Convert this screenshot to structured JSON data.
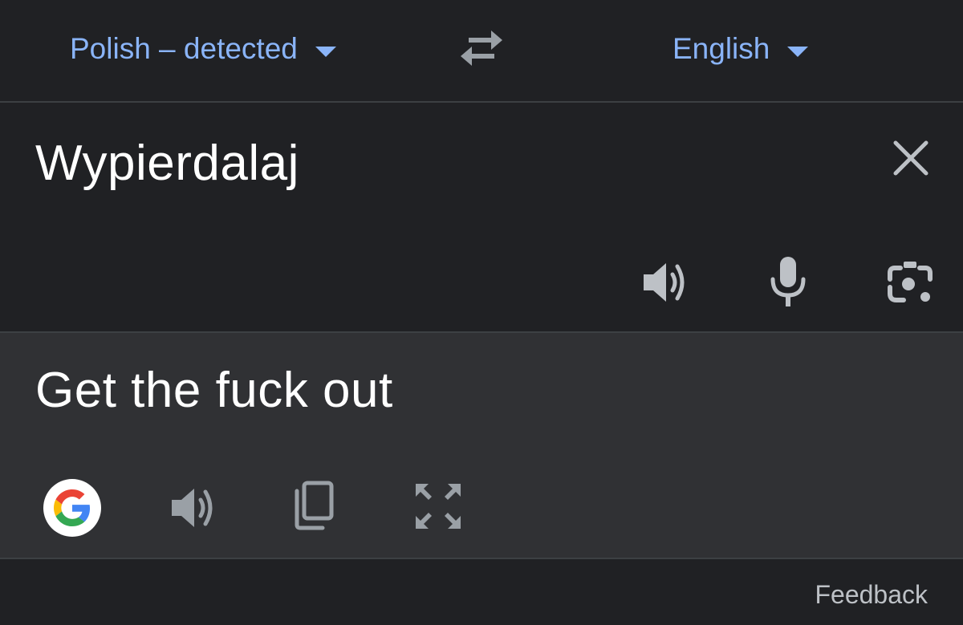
{
  "header": {
    "source_language": "Polish – detected",
    "target_language": "English"
  },
  "source": {
    "text": "Wypierdalaj"
  },
  "translation": {
    "text": "Get the fuck out"
  },
  "footer": {
    "feedback_label": "Feedback"
  },
  "colors": {
    "accent": "#8ab4f8",
    "background": "#202124",
    "result_background": "#303134",
    "icon": "#9aa0a6"
  },
  "icons": {
    "swap": "swap-arrows-icon",
    "clear": "close-icon",
    "source_listen": "speaker-icon",
    "mic": "microphone-icon",
    "camera": "camera-icon",
    "google": "google-g-logo",
    "translation_listen": "speaker-icon",
    "copy": "copy-icon",
    "fullscreen": "fullscreen-icon"
  }
}
